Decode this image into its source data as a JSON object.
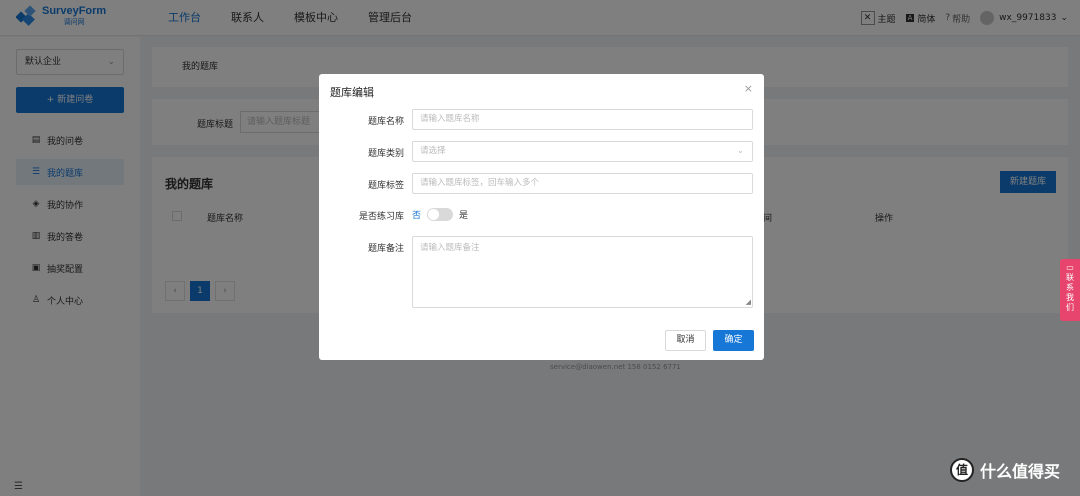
{
  "app": {
    "name": "SurveyForm",
    "sub": "调问网"
  },
  "nav": {
    "items": [
      "工作台",
      "联系人",
      "模板中心",
      "管理后台"
    ]
  },
  "topright": {
    "theme": "主题",
    "lang": "简体",
    "help": "帮助",
    "user": "wx_9971833"
  },
  "sidebar": {
    "org": "默认企业",
    "new_survey": "+ 新建问卷",
    "items": [
      {
        "label": "我的问卷",
        "icon": "survey-icon"
      },
      {
        "label": "我的题库",
        "icon": "database-icon"
      },
      {
        "label": "我的协作",
        "icon": "handshake-icon"
      },
      {
        "label": "我的答卷",
        "icon": "answer-icon"
      },
      {
        "label": "抽奖配置",
        "icon": "gift-icon"
      },
      {
        "label": "个人中心",
        "icon": "user-icon"
      }
    ]
  },
  "breadcrumb": "我的题库",
  "filter": {
    "label": "题库标题",
    "placeholder": "请输入题库标题"
  },
  "list": {
    "title": "我的题库",
    "new_button": "新建题库",
    "headers": [
      "题库名称",
      "间",
      "操作"
    ],
    "page": "1",
    "prev": "‹",
    "next": "›"
  },
  "footer": "service@diaowen.net 158 0152 6771",
  "modal": {
    "title": "题库编辑",
    "close": "×",
    "name_label": "题库名称",
    "name_placeholder": "请输入题库名称",
    "type_label": "题库类别",
    "type_placeholder": "请选择",
    "tag_label": "题库标签",
    "tag_placeholder": "请输入题库标签，回车输入多个",
    "practice_label": "是否练习库",
    "practice_no": "否",
    "practice_yes": "是",
    "practice_on": false,
    "remark_label": "题库备注",
    "remark_placeholder": "请输入题库备注",
    "cancel": "取消",
    "ok": "确定"
  },
  "contact": "联系我们",
  "watermark": "什么值得买",
  "colors": {
    "accent": "#1777d6",
    "contact": "#e8456e"
  }
}
